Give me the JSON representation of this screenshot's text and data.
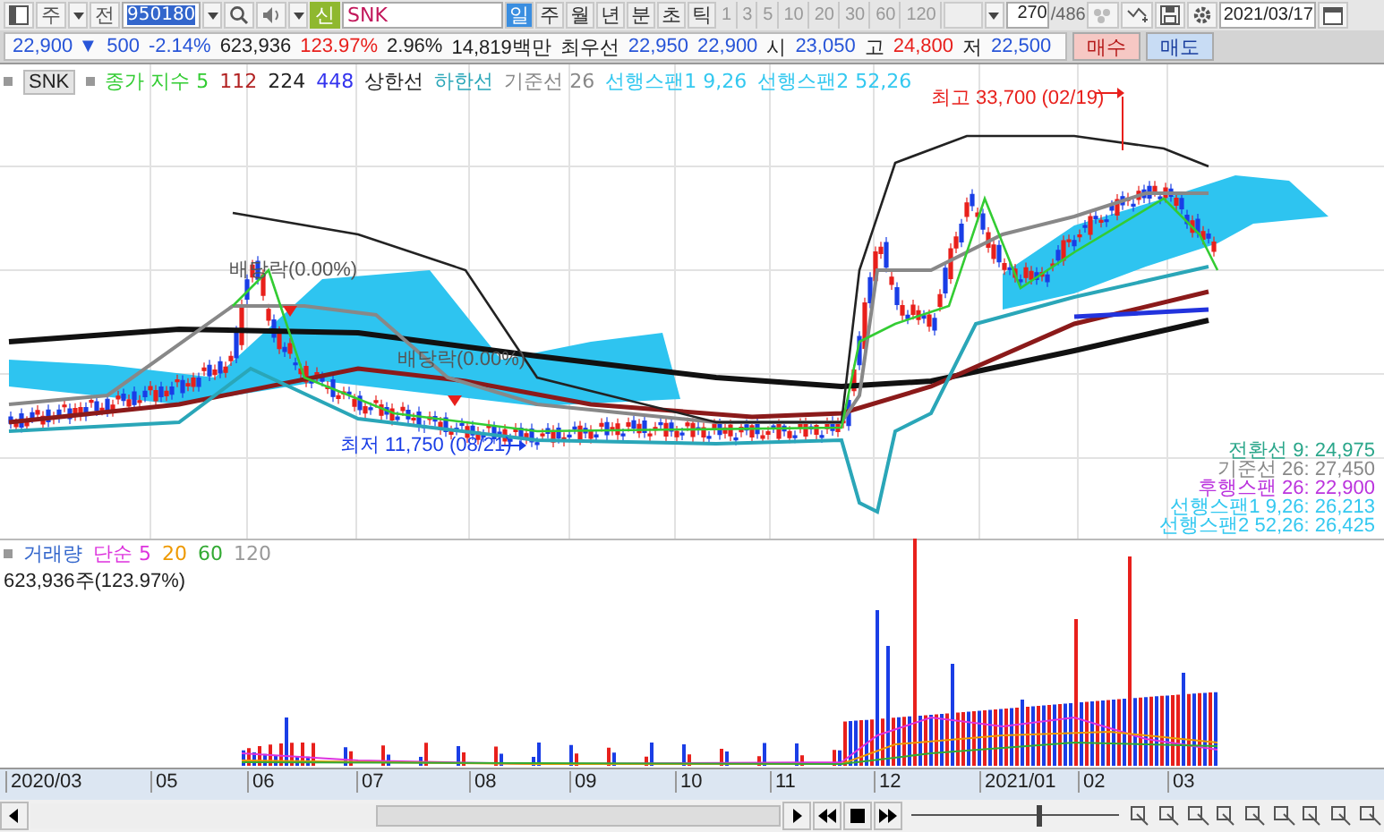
{
  "toolbar": {
    "market_label": "주",
    "type_label": "전",
    "code": "950180",
    "tag": "신",
    "name": "SNK",
    "periods": [
      {
        "label": "일",
        "selected": true
      },
      {
        "label": "주",
        "selected": false
      },
      {
        "label": "월",
        "selected": false
      },
      {
        "label": "년",
        "selected": false
      },
      {
        "label": "분",
        "selected": false
      },
      {
        "label": "초",
        "selected": false
      },
      {
        "label": "틱",
        "selected": false
      }
    ],
    "intervals": [
      "1",
      "3",
      "5",
      "10",
      "20",
      "30",
      "60",
      "120"
    ],
    "count": "270",
    "total": "/486",
    "date": "2021/03/17"
  },
  "quote": [
    {
      "text": "22,900 ▼",
      "color": "#2855d8"
    },
    {
      "text": "500",
      "color": "#2855d8"
    },
    {
      "text": "-2.14%",
      "color": "#2855d8"
    },
    {
      "text": "623,936",
      "color": "#222222"
    },
    {
      "text": "123.97%",
      "color": "#e8201c"
    },
    {
      "text": "2.96%",
      "color": "#222222"
    },
    {
      "text": "14,819백만",
      "color": "#222222"
    },
    {
      "text": "최우선",
      "color": "#222222"
    },
    {
      "text": "22,950",
      "color": "#2855d8"
    },
    {
      "text": "22,900",
      "color": "#2855d8"
    },
    {
      "text": "시",
      "color": "#222222"
    },
    {
      "text": "23,050",
      "color": "#2855d8"
    },
    {
      "text": "고",
      "color": "#222222"
    },
    {
      "text": "24,800",
      "color": "#e8201c"
    },
    {
      "text": "저",
      "color": "#222222"
    },
    {
      "text": "22,500",
      "color": "#2855d8"
    }
  ],
  "order_buttons": [
    {
      "label": "매수",
      "kind": "buy"
    },
    {
      "label": "매도",
      "kind": "sell"
    }
  ],
  "price_legend": {
    "title": "SNK",
    "items": [
      {
        "text": "종가 지수 5",
        "color": "#33cc33"
      },
      {
        "text": "112",
        "color": "#b22222"
      },
      {
        "text": "224",
        "color": "#222222"
      },
      {
        "text": "448",
        "color": "#3333ee"
      },
      {
        "text": "상한선",
        "color": "#222222"
      },
      {
        "text": "하한선",
        "color": "#2aa6b8"
      },
      {
        "text": "기준선 26",
        "color": "#888888"
      },
      {
        "text": "선행스팬1 9,26",
        "color": "#33c8f0"
      },
      {
        "text": "선행스팬2 52,26",
        "color": "#33c8f0"
      }
    ]
  },
  "annotations": [
    {
      "text": "최고 33,700 (02/19)",
      "kind": "high"
    },
    {
      "text": "배당락(0.00%)",
      "kind": "event"
    },
    {
      "text": "배당락(0.00%)",
      "kind": "event"
    },
    {
      "text": "최저 11,750 (08/21)",
      "kind": "low"
    }
  ],
  "indicator_values": [
    {
      "text": "전환선 9: 24,975",
      "color": "#2aa68a"
    },
    {
      "text": "기준선 26: 27,450",
      "color": "#888888"
    },
    {
      "text": "후행스팬 26: 22,900",
      "color": "#bb33dd"
    },
    {
      "text": "선행스팬1 9,26: 26,213",
      "color": "#33c8f0"
    },
    {
      "text": "선행스팬2 52,26: 26,425",
      "color": "#33c8f0"
    }
  ],
  "volume_legend": {
    "items": [
      {
        "text": "거래량",
        "color": "#3366cc"
      },
      {
        "text": "단순 5",
        "color": "#dd33dd"
      },
      {
        "text": "20",
        "color": "#ee9900"
      },
      {
        "text": "60",
        "color": "#33aa33"
      },
      {
        "text": "120",
        "color": "#999999"
      }
    ],
    "value": "623,936주(123.97%)"
  },
  "x_axis": [
    "2020/03",
    "05",
    "06",
    "07",
    "08",
    "09",
    "10",
    "11",
    "12",
    "2021/01",
    "02",
    "03"
  ],
  "zoom_slider": {
    "level": 0.6
  }
}
